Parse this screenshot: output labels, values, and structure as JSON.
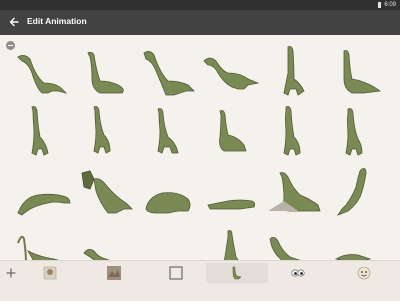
{
  "status_bar": {
    "time": "6:09"
  },
  "app_bar": {
    "title": "Edit Animation",
    "back_icon": "arrow-back-icon"
  },
  "grid": {
    "remove_icon": "remove-circle-icon",
    "frame_count_rows": 4
  },
  "toolbar": {
    "tools": [
      {
        "name": "add-frame",
        "icon": "plus-icon"
      },
      {
        "name": "character-picker",
        "icon": "character-thumbnail-icon"
      },
      {
        "name": "background-picker",
        "icon": "background-thumbnail-icon"
      },
      {
        "name": "frame-picker",
        "icon": "square-frame-icon"
      },
      {
        "name": "dinosaur-animation",
        "icon": "dinosaur-thumbnail-icon",
        "selected": true
      },
      {
        "name": "eyes-tool",
        "icon": "eyes-icon"
      },
      {
        "name": "sticker-tool",
        "icon": "character-face-icon"
      }
    ]
  },
  "colors": {
    "app_bar": "#424242",
    "status_bar": "#303030",
    "canvas": "#f5f1ec",
    "dino_body": "#7a8a55",
    "dino_shadow": "#4f5b33"
  }
}
